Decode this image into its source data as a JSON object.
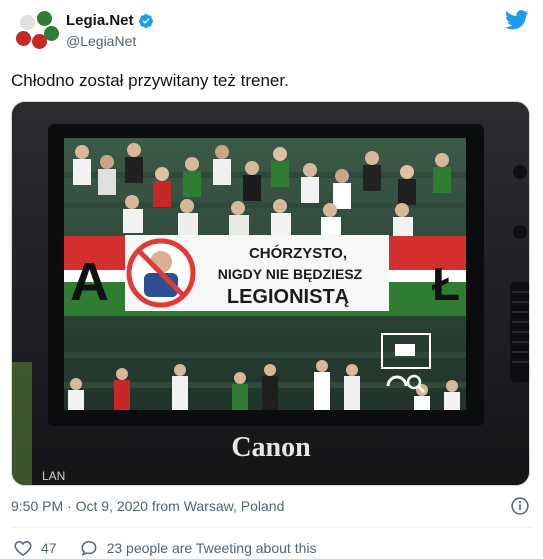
{
  "user": {
    "display_name": "Legia.Net",
    "handle": "@LegiaNet",
    "verified_icon": "verified-badge-icon",
    "avatar_colors": [
      "#2e7d32",
      "#c62828",
      "#9e9e9e"
    ]
  },
  "tweet": {
    "text": "Chłodno został przywitany też trener.",
    "timestamp": "9:50 PM · Oct 9, 2020 from Warsaw, Poland"
  },
  "media": {
    "banner_line1": "CHÓRZYSTO,",
    "banner_line2": "NIGDY NIE BĘDZIESZ",
    "banner_line3": "LEGIONISTĄ",
    "camera_brand": "Canon",
    "camera_port_label": "LAN",
    "big_letter_left": "A",
    "big_letter_right": "Ł"
  },
  "actions": {
    "likes": "47",
    "conversation": "23 people are Tweeting about this"
  },
  "colors": {
    "accent": "#1d9bf0",
    "text_secondary": "#536471",
    "flag_red": "#d32f2f",
    "flag_green": "#2e7d32"
  }
}
